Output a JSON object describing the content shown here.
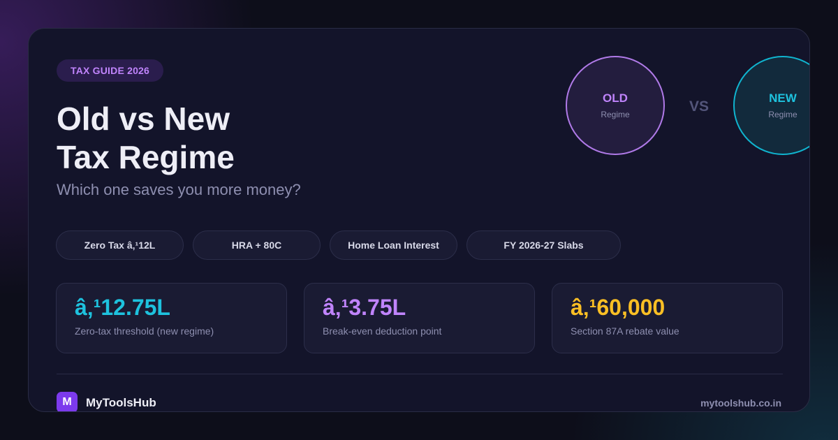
{
  "badge": "TAX GUIDE 2026",
  "title": {
    "line1": "Old vs New",
    "line2": "Tax Regime"
  },
  "subtitle": "Which one saves you more money?",
  "regimes": {
    "old": {
      "label": "OLD",
      "sub": "Regime",
      "color": "#c084fc"
    },
    "vs": "VS",
    "new": {
      "label": "NEW",
      "sub": "Regime",
      "color": "#1ec2de"
    }
  },
  "tags": [
    "Zero Tax â‚¹12L",
    "HRA + 80C",
    "Home Loan Interest",
    "FY 2026-27 Slabs"
  ],
  "stats": [
    {
      "value": "â‚¹12.75L",
      "label": "Zero-tax threshold (new regime)",
      "color": "#1ec2de"
    },
    {
      "value": "â‚¹3.75L",
      "label": "Break-even deduction point",
      "color": "#c084fc"
    },
    {
      "value": "â‚¹60,000",
      "label": "Section 87A rebate value",
      "color": "#fbbf24"
    }
  ],
  "footer": {
    "logo_letter": "M",
    "brand": "MyToolsHub",
    "site": "mytoolshub.co.in"
  }
}
